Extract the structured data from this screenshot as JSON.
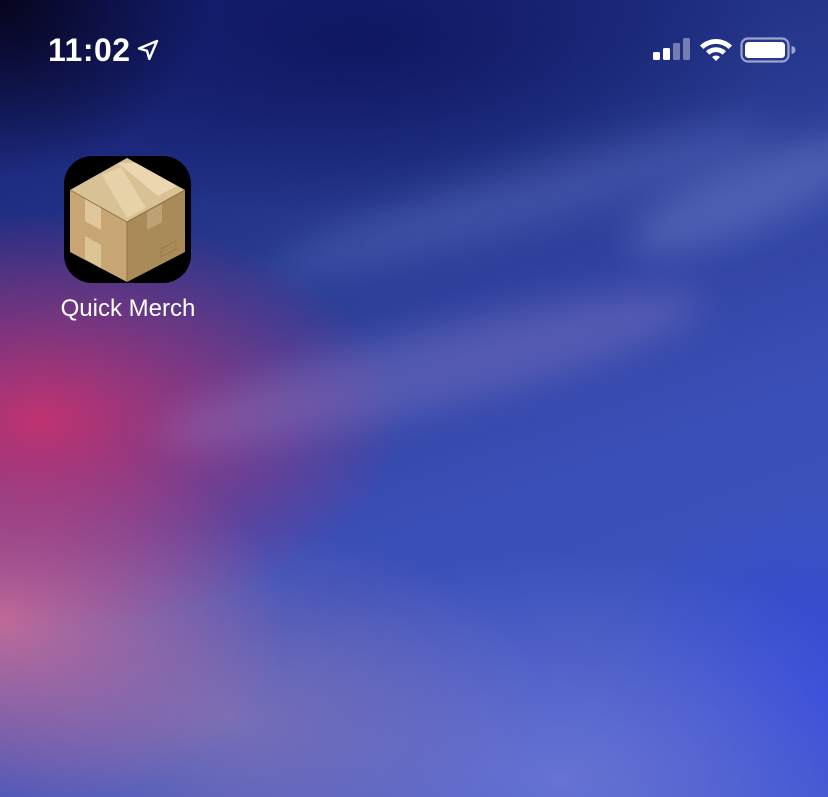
{
  "status_bar": {
    "time": "11:02",
    "icons": [
      "location-arrow-icon",
      "cellular-signal-icon",
      "wifi-icon",
      "battery-icon"
    ]
  },
  "home_screen": {
    "apps": [
      {
        "label": "Quick Merch",
        "icon": "cardboard-box-icon"
      }
    ]
  },
  "colors": {
    "status_text": "#ffffff",
    "app_icon_background": "#000000",
    "box_light": "#d8bf92",
    "box_mid": "#c7a875",
    "box_dark": "#a98a59",
    "tape": "#ecd9b4"
  }
}
